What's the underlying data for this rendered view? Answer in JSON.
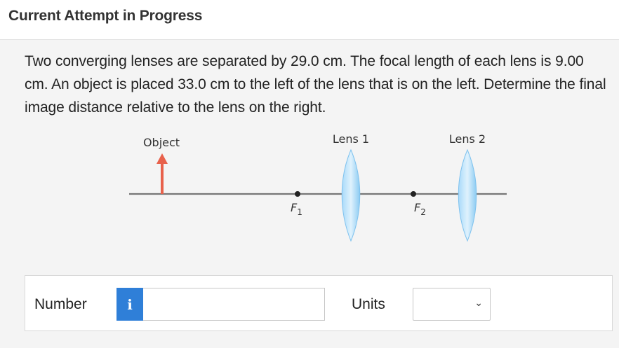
{
  "header": {
    "title": "Current Attempt in Progress"
  },
  "question": {
    "text": "Two converging lenses are separated by 29.0 cm. The focal length of each lens is 9.00 cm. An object is placed 33.0 cm to the left of the lens that is on the left. Determine the final image distance relative to the lens on the right."
  },
  "diagram": {
    "object_label": "Object",
    "lens1_label": "Lens 1",
    "lens2_label": "Lens 2",
    "f1_letter": "F",
    "f1_sub": "1",
    "f2_letter": "F",
    "f2_sub": "2",
    "colors": {
      "axis": "#777777",
      "arrow": "#e8614b",
      "lens": "#8ccbf2",
      "focal_point": "#222222"
    }
  },
  "answer": {
    "number_label": "Number",
    "info_icon": "i",
    "number_value": "",
    "units_label": "Units",
    "units_selected": "",
    "chevron_icon": "chevron-down-icon"
  }
}
